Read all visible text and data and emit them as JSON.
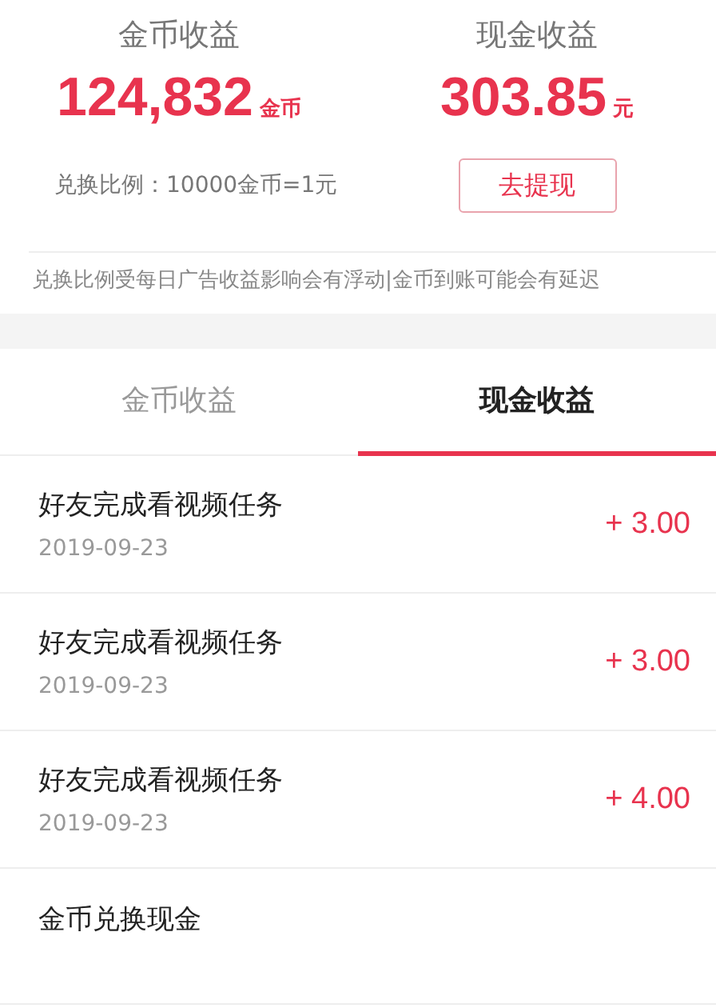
{
  "summary": [
    {
      "label": "金币收益",
      "amount": "124,832",
      "unit": "金币"
    },
    {
      "label": "现金收益",
      "amount": "303.85",
      "unit": "元"
    }
  ],
  "exchange_rate": "兑换比例：10000金币=1元",
  "withdraw_button": "去提现",
  "notice": "兑换比例受每日广告收益影响会有浮动|金币到账可能会有延迟",
  "tabs": [
    {
      "label": "金币收益",
      "selected": false
    },
    {
      "label": "现金收益",
      "selected": true
    }
  ],
  "records": [
    {
      "title": "好友完成看视频任务",
      "date": "2019-09-23",
      "amount": "+ 3.00"
    },
    {
      "title": "好友完成看视频任务",
      "date": "2019-09-23",
      "amount": "+ 3.00"
    },
    {
      "title": "好友完成看视频任务",
      "date": "2019-09-23",
      "amount": "+ 4.00"
    },
    {
      "title": "金币兑换现金"
    }
  ]
}
